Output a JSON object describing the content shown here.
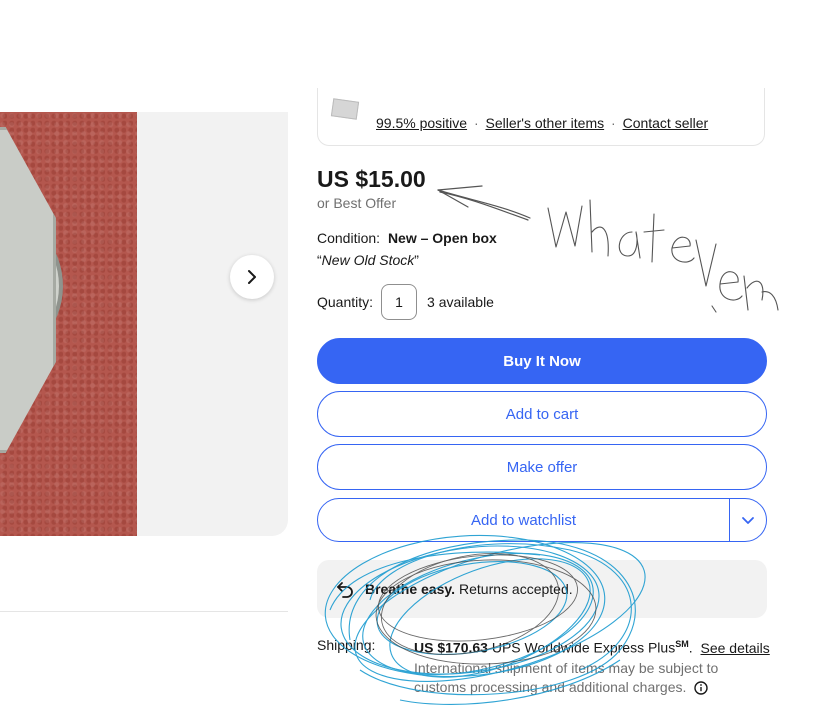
{
  "seller": {
    "feedback": "99.5% positive",
    "other_items": "Seller's other items",
    "contact": "Contact seller",
    "separator": "·"
  },
  "item": {
    "price": "US $15.00",
    "best_offer": "or Best Offer",
    "condition_label": "Condition:",
    "condition_value": "New – Open box",
    "condition_note": "New Old Stock",
    "quantity_label": "Quantity:",
    "quantity_value": "1",
    "available": "3 available"
  },
  "actions": {
    "buy_now": "Buy It Now",
    "add_to_cart": "Add to cart",
    "make_offer": "Make offer",
    "add_to_watchlist": "Add to watchlist"
  },
  "returns": {
    "strong": "Breathe easy.",
    "text": "Returns accepted."
  },
  "shipping": {
    "label": "Shipping:",
    "price": "US $170.63",
    "service": "UPS Worldwide Express Plus",
    "service_mark": "SM",
    "see_details": "See details",
    "note": "International shipment of items may be subject to customs processing and additional charges."
  },
  "annotation": {
    "handwriting": "whatever"
  },
  "colors": {
    "accent": "#3665f3",
    "scribble_blue": "#1a9bd0",
    "ink": "#555555"
  },
  "icons": [
    "chevron-right-icon",
    "chevron-down-icon",
    "return-arrow-icon",
    "info-icon"
  ]
}
